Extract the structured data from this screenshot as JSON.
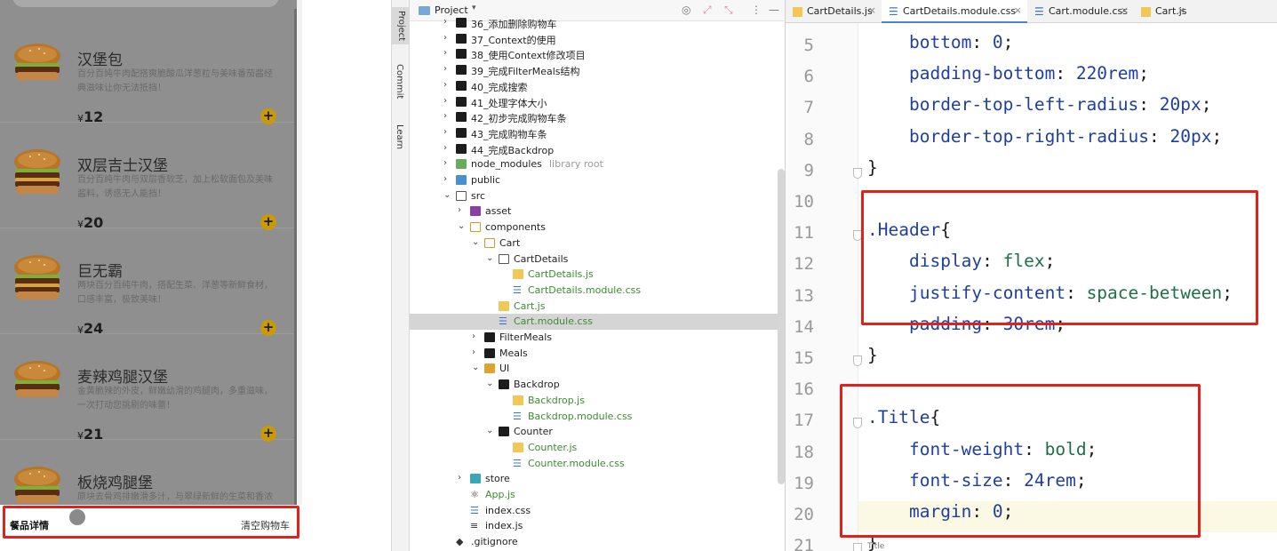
{
  "phone": {
    "meals": [
      {
        "name": "汉堡包",
        "desc": "百分百纯牛肉配搭爽脆酸瓜洋葱粒与美味番茄酱经典滋味让你无法抵挡！",
        "price_symbol": "¥",
        "price": "12"
      },
      {
        "name": "双层吉士汉堡",
        "desc": "百分百纯牛肉与双层香软芝，加上松软面包及美味酱料，诱惑无人能挡！",
        "price_symbol": "¥",
        "price": "20"
      },
      {
        "name": "巨无霸",
        "desc": "两块百分百纯牛肉，搭配生菜、洋葱等新鲜食材，口感丰富，极致美味！",
        "price_symbol": "¥",
        "price": "24"
      },
      {
        "name": "麦辣鸡腿汉堡",
        "desc": "金黄脆辣的外皮，鲜嫩幼滑的鸡腿肉，多重滋味，一次打动您挑剔的味蕾！",
        "price_symbol": "¥",
        "price": "21"
      },
      {
        "name": "板烧鸡腿堡",
        "desc": "原块去骨鸡排嫩滑多汁，与翠绿新鲜的生菜和香浓烧鸡酱搭配，口感丰富！",
        "price_symbol": "¥",
        "price": ""
      }
    ],
    "add_symbol": "+",
    "cart": {
      "title": "餐品详情",
      "clear_label": "清空购物车"
    }
  },
  "ide": {
    "tool_tabs": [
      "Project",
      "Commit",
      "Learn"
    ],
    "project_header": {
      "title": "Project",
      "arrow": "▾"
    },
    "tree": [
      {
        "depth": 0,
        "arrow": "›",
        "icon": "folder-dark",
        "label": "36_添加删除购物车"
      },
      {
        "depth": 0,
        "arrow": "›",
        "icon": "folder-dark",
        "label": "37_Context的使用"
      },
      {
        "depth": 0,
        "arrow": "›",
        "icon": "folder-dark",
        "label": "38_使用Context修改项目"
      },
      {
        "depth": 0,
        "arrow": "›",
        "icon": "folder-dark",
        "label": "39_完成FilterMeals结构"
      },
      {
        "depth": 0,
        "arrow": "›",
        "icon": "folder-dark",
        "label": "40_完成搜索"
      },
      {
        "depth": 0,
        "arrow": "›",
        "icon": "folder-dark",
        "label": "41_处理字体大小"
      },
      {
        "depth": 0,
        "arrow": "›",
        "icon": "folder-dark",
        "label": "42_初步完成购物车条"
      },
      {
        "depth": 0,
        "arrow": "›",
        "icon": "folder-dark",
        "label": "43_完成购物车条"
      },
      {
        "depth": 0,
        "arrow": "›",
        "icon": "folder-dark",
        "label": "44_完成Backdrop"
      },
      {
        "depth": 0,
        "arrow": "›",
        "icon": "folder-green",
        "label": "node_modules",
        "extra": "library root"
      },
      {
        "depth": 0,
        "arrow": "›",
        "icon": "folder-blue",
        "label": "public"
      },
      {
        "depth": 0,
        "arrow": "⌄",
        "icon": "folder-open",
        "label": "src"
      },
      {
        "depth": 1,
        "arrow": "›",
        "icon": "folder-purple",
        "label": "asset"
      },
      {
        "depth": 1,
        "arrow": "⌄",
        "icon": "folder-outline-orange",
        "label": "components"
      },
      {
        "depth": 2,
        "arrow": "⌄",
        "icon": "folder-outline-orange",
        "label": "Cart"
      },
      {
        "depth": 3,
        "arrow": "⌄",
        "icon": "folder-open",
        "label": "CartDetails"
      },
      {
        "depth": 4,
        "arrow": "",
        "icon": "js",
        "label": "CartDetails.js",
        "green": true
      },
      {
        "depth": 4,
        "arrow": "",
        "icon": "css",
        "label": "CartDetails.module.css",
        "green": true
      },
      {
        "depth": 3,
        "arrow": "",
        "icon": "js",
        "label": "Cart.js",
        "green": true
      },
      {
        "depth": 3,
        "arrow": "",
        "icon": "css",
        "label": "Cart.module.css",
        "green": true,
        "selected": true
      },
      {
        "depth": 2,
        "arrow": "›",
        "icon": "folder-dark",
        "label": "FilterMeals"
      },
      {
        "depth": 2,
        "arrow": "›",
        "icon": "folder-dark",
        "label": "Meals"
      },
      {
        "depth": 2,
        "arrow": "⌄",
        "icon": "folder-orange",
        "label": "UI"
      },
      {
        "depth": 3,
        "arrow": "⌄",
        "icon": "folder-dark",
        "label": "Backdrop"
      },
      {
        "depth": 4,
        "arrow": "",
        "icon": "js",
        "label": "Backdrop.js",
        "green": true
      },
      {
        "depth": 4,
        "arrow": "",
        "icon": "css",
        "label": "Backdrop.module.css",
        "green": true
      },
      {
        "depth": 3,
        "arrow": "⌄",
        "icon": "folder-dark",
        "label": "Counter"
      },
      {
        "depth": 4,
        "arrow": "",
        "icon": "js",
        "label": "Counter.js",
        "green": true
      },
      {
        "depth": 4,
        "arrow": "",
        "icon": "css",
        "label": "Counter.module.css",
        "green": true
      },
      {
        "depth": 1,
        "arrow": "›",
        "icon": "folder-teal",
        "label": "store"
      },
      {
        "depth": 1,
        "arrow": "",
        "icon": "react",
        "label": "App.js",
        "green": true
      },
      {
        "depth": 1,
        "arrow": "",
        "icon": "css",
        "label": "index.css"
      },
      {
        "depth": 1,
        "arrow": "",
        "icon": "js-list",
        "label": "index.js"
      },
      {
        "depth": 0,
        "arrow": "",
        "icon": "git",
        "label": ".gitignore"
      }
    ],
    "editor_tabs": [
      {
        "label": "CartDetails.js",
        "icon": "js",
        "close": "×"
      },
      {
        "label": "CartDetails.module.css",
        "icon": "css",
        "close": "×",
        "active": true
      },
      {
        "label": "Cart.module.css",
        "icon": "css",
        "close": "×"
      },
      {
        "label": "Cart.js",
        "icon": "js",
        "close": "×"
      }
    ],
    "code": [
      {
        "num": "5",
        "tokens": [
          [
            "p",
            "    "
          ],
          [
            "prop",
            "bottom"
          ],
          [
            "p",
            ": "
          ],
          [
            "num",
            "0"
          ],
          [
            "p",
            ";"
          ]
        ]
      },
      {
        "num": "6",
        "tokens": [
          [
            "p",
            "    "
          ],
          [
            "prop",
            "padding-bottom"
          ],
          [
            "p",
            ": "
          ],
          [
            "num",
            "220rem"
          ],
          [
            "p",
            ";"
          ]
        ]
      },
      {
        "num": "7",
        "tokens": [
          [
            "p",
            "    "
          ],
          [
            "prop",
            "border-top-left-radius"
          ],
          [
            "p",
            ": "
          ],
          [
            "num",
            "20px"
          ],
          [
            "p",
            ";"
          ]
        ]
      },
      {
        "num": "8",
        "tokens": [
          [
            "p",
            "    "
          ],
          [
            "prop",
            "border-top-right-radius"
          ],
          [
            "p",
            ": "
          ],
          [
            "num",
            "20px"
          ],
          [
            "p",
            ";"
          ]
        ]
      },
      {
        "num": "9",
        "tokens": [
          [
            "p",
            "}"
          ]
        ],
        "fold": true
      },
      {
        "num": "10",
        "tokens": []
      },
      {
        "num": "11",
        "tokens": [
          [
            "sel",
            ".Header"
          ],
          [
            "p",
            "{"
          ]
        ],
        "fold": true
      },
      {
        "num": "12",
        "tokens": [
          [
            "p",
            "    "
          ],
          [
            "prop",
            "display"
          ],
          [
            "p",
            ": "
          ],
          [
            "val",
            "flex"
          ],
          [
            "p",
            ";"
          ]
        ]
      },
      {
        "num": "13",
        "tokens": [
          [
            "p",
            "    "
          ],
          [
            "prop",
            "justify-content"
          ],
          [
            "p",
            ": "
          ],
          [
            "val",
            "space-between"
          ],
          [
            "p",
            ";"
          ]
        ]
      },
      {
        "num": "14",
        "tokens": [
          [
            "p",
            "    "
          ],
          [
            "prop",
            "padding"
          ],
          [
            "p",
            ": "
          ],
          [
            "num",
            "30rem"
          ],
          [
            "p",
            ";"
          ]
        ]
      },
      {
        "num": "15",
        "tokens": [
          [
            "p",
            "}"
          ]
        ],
        "fold": true
      },
      {
        "num": "16",
        "tokens": []
      },
      {
        "num": "17",
        "tokens": [
          [
            "sel",
            ".Title"
          ],
          [
            "p",
            "{"
          ]
        ],
        "fold": true
      },
      {
        "num": "18",
        "tokens": [
          [
            "p",
            "    "
          ],
          [
            "prop",
            "font-weight"
          ],
          [
            "p",
            ": "
          ],
          [
            "val",
            "bold"
          ],
          [
            "p",
            ";"
          ]
        ]
      },
      {
        "num": "19",
        "tokens": [
          [
            "p",
            "    "
          ],
          [
            "prop",
            "font-size"
          ],
          [
            "p",
            ": "
          ],
          [
            "num",
            "24rem"
          ],
          [
            "p",
            ";"
          ]
        ]
      },
      {
        "num": "20",
        "tokens": [
          [
            "p",
            "    "
          ],
          [
            "prop",
            "margin"
          ],
          [
            "p",
            ": "
          ],
          [
            "num",
            "0"
          ],
          [
            "p",
            ";"
          ]
        ],
        "current": true
      },
      {
        "num": "21",
        "tokens": [
          [
            "p",
            "}"
          ]
        ],
        "fold": true
      }
    ],
    "footer_hint": "Title"
  },
  "colors": {
    "highlight_box": "#e3211c",
    "plus_button": "#c89a08"
  }
}
